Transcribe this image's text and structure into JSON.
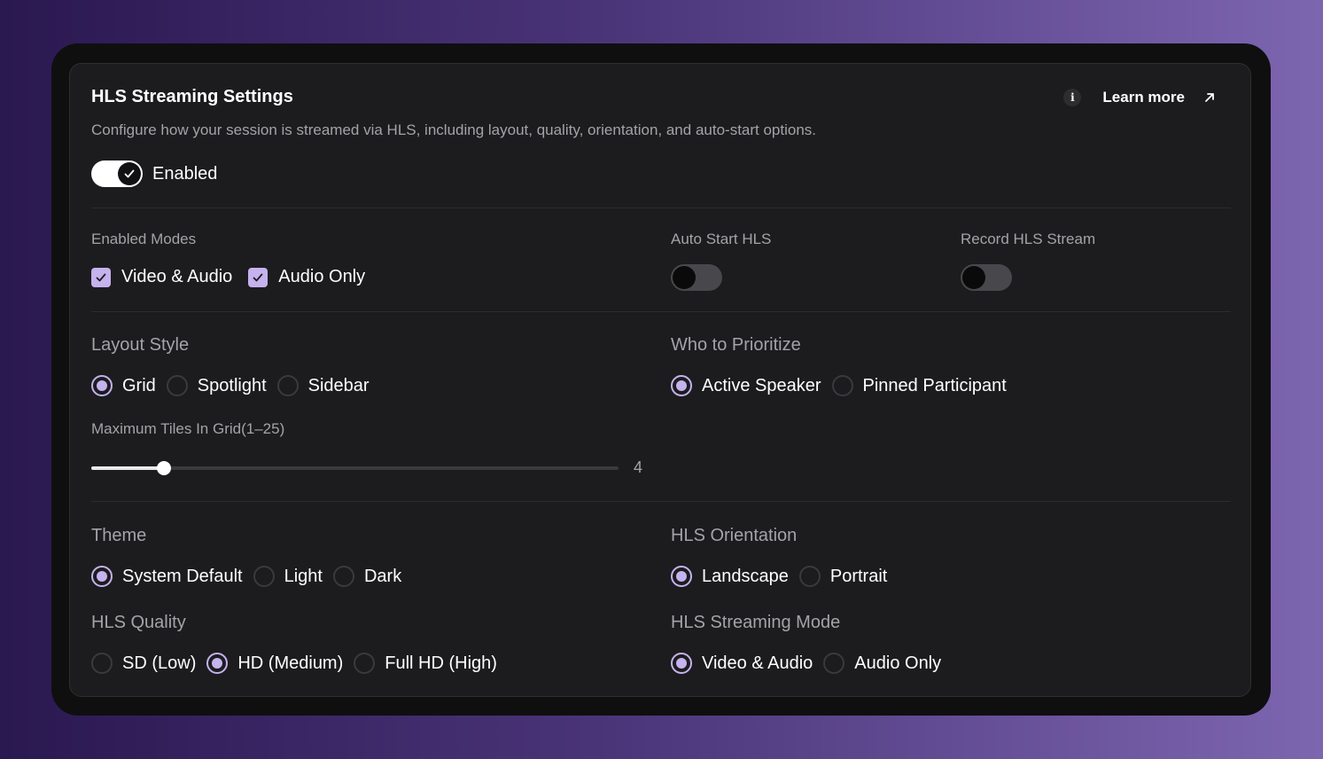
{
  "header": {
    "title": "HLS Streaming Settings",
    "description": "Configure how your session is streamed via HLS, including layout, quality, orientation, and auto-start options.",
    "info_icon": "info-icon",
    "learn_more_label": "Learn more",
    "learn_more_icon": "arrow-up-right-icon"
  },
  "enabled_toggle": {
    "label": "Enabled",
    "on": true
  },
  "enabled_modes": {
    "label": "Enabled Modes",
    "options": [
      {
        "label": "Video & Audio",
        "checked": true
      },
      {
        "label": "Audio Only",
        "checked": true
      }
    ]
  },
  "auto_start": {
    "label": "Auto Start HLS",
    "on": false
  },
  "record": {
    "label": "Record HLS Stream",
    "on": false
  },
  "layout_style": {
    "label": "Layout Style",
    "options": [
      "Grid",
      "Spotlight",
      "Sidebar"
    ],
    "selected": "Grid"
  },
  "prioritize": {
    "label": "Who to Prioritize",
    "options": [
      "Active Speaker",
      "Pinned Participant"
    ],
    "selected": "Active Speaker"
  },
  "max_tiles": {
    "label": "Maximum Tiles In Grid(1–25)",
    "min": 1,
    "max": 25,
    "value": "4"
  },
  "theme": {
    "label": "Theme",
    "options": [
      "System Default",
      "Light",
      "Dark"
    ],
    "selected": "System Default"
  },
  "orientation": {
    "label": "HLS Orientation",
    "options": [
      "Landscape",
      "Portrait"
    ],
    "selected": "Landscape"
  },
  "quality": {
    "label": "HLS Quality",
    "options": [
      "SD (Low)",
      "HD (Medium)",
      "Full HD (High)"
    ],
    "selected": "HD (Medium)"
  },
  "streaming_mode": {
    "label": "HLS Streaming Mode",
    "options": [
      "Video & Audio",
      "Audio Only"
    ],
    "selected": "Video & Audio"
  },
  "colors": {
    "accent": "#c5b2ee",
    "card_bg": "#1c1c1e",
    "text_muted": "#a3a3a8"
  }
}
